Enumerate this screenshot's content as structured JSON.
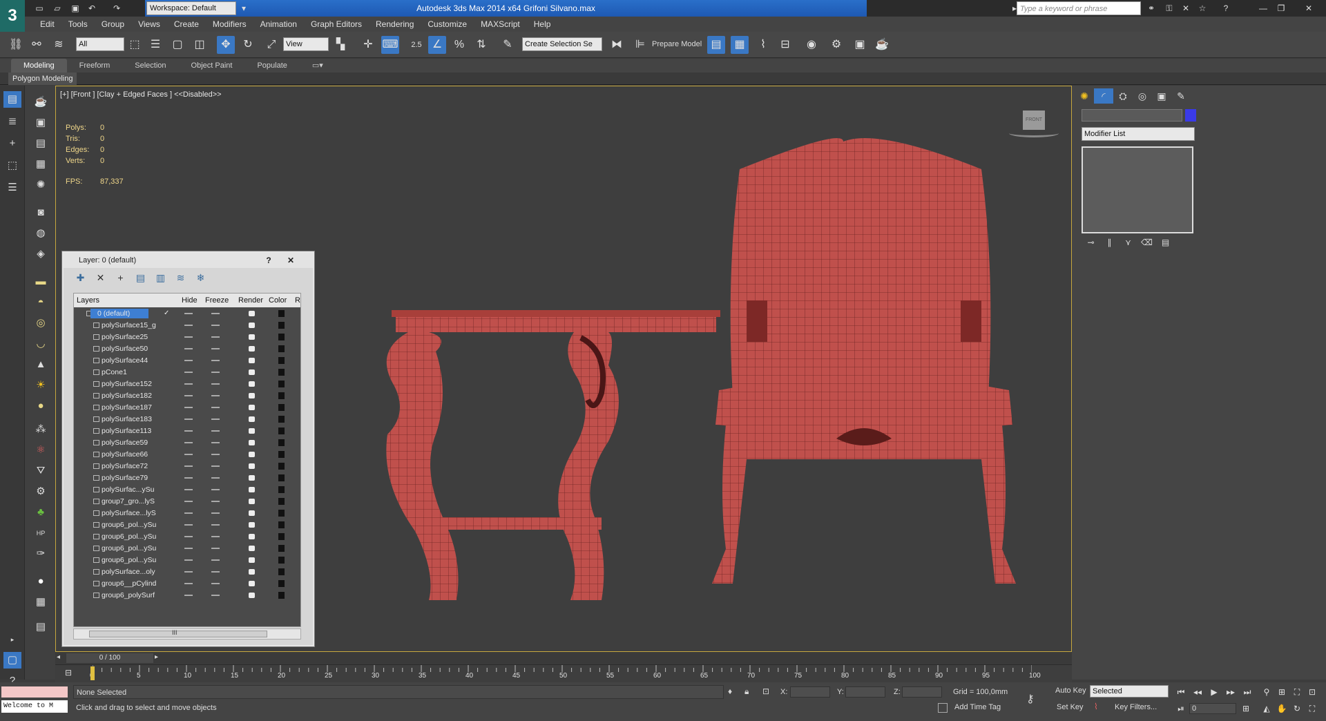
{
  "app": {
    "title": "Autodesk 3ds Max  2014 x64     Grifoni Silvano.max",
    "logo": "3",
    "workspace": "Workspace: Default",
    "search_placeholder": "Type a keyword or phrase"
  },
  "menu": [
    "Edit",
    "Tools",
    "Group",
    "Views",
    "Create",
    "Modifiers",
    "Animation",
    "Graph Editors",
    "Rendering",
    "Customize",
    "MAXScript",
    "Help"
  ],
  "toolbar": {
    "selection_filter": "All",
    "ref_coord": "View",
    "snap_label": "2.5",
    "named_selection": "Create Selection Se",
    "prepare_model": "Prepare Model"
  },
  "ribbon": {
    "tabs": [
      "Modeling",
      "Freeform",
      "Selection",
      "Object Paint",
      "Populate"
    ],
    "active": "Modeling",
    "panel_label": "Polygon Modeling"
  },
  "viewport": {
    "label": "[+] [Front ] [Clay + Edged Faces ]  <<Disabled>>",
    "stats": [
      {
        "k": "Polys:",
        "v": "0"
      },
      {
        "k": "Tris:",
        "v": "0"
      },
      {
        "k": "Edges:",
        "v": "0"
      },
      {
        "k": "Verts:",
        "v": "0"
      }
    ],
    "fps_label": "FPS:",
    "fps_value": "87,337",
    "navcube_label": "FRONT",
    "model_color": "#c0504c"
  },
  "layer_window": {
    "title": "Layer: 0 (default)",
    "help": "?",
    "close": "✕",
    "columns": [
      "Layers",
      "Hide",
      "Freeze",
      "Render",
      "Color",
      "R"
    ],
    "default_layer": "0 (default)",
    "objects": [
      "polySurface15_g",
      "polySurface25",
      "polySurface50",
      "polySurface44",
      "pCone1",
      "polySurface152",
      "polySurface182",
      "polySurface187",
      "polySurface183",
      "polySurface113",
      "polySurface59",
      "polySurface66",
      "polySurface72",
      "polySurface79",
      "polySurfac...ySu",
      "group7_gro...lyS",
      "polySurface...lyS",
      "group6_pol...ySu",
      "group6_pol...ySu",
      "group6_pol...ySu",
      "group6_pol...ySu",
      "polySurface...oly",
      "group6__pCylind",
      "group6_polySurf"
    ],
    "scroll_mark": "III"
  },
  "command_panel": {
    "modifier_list": "Modifier List",
    "object_color": "#3a3ae8"
  },
  "timeline": {
    "slider": "0 / 100",
    "ticks": [
      "0",
      "5",
      "10",
      "15",
      "20",
      "25",
      "30",
      "35",
      "40",
      "45",
      "50",
      "55",
      "60",
      "65",
      "70",
      "75",
      "80",
      "85",
      "90",
      "95",
      "100"
    ],
    "frame_position": 0
  },
  "status": {
    "listener_text": "Welcome to M",
    "selection": "None Selected",
    "prompt": "Click and drag to select and move objects",
    "x_label": "X:",
    "y_label": "Y:",
    "z_label": "Z:",
    "grid": "Grid = 100,0mm",
    "add_time_tag": "Add Time Tag",
    "auto_key": "Auto Key",
    "set_key": "Set Key",
    "selected_combo": "Selected",
    "key_filters": "Key Filters...",
    "frame": "0"
  }
}
